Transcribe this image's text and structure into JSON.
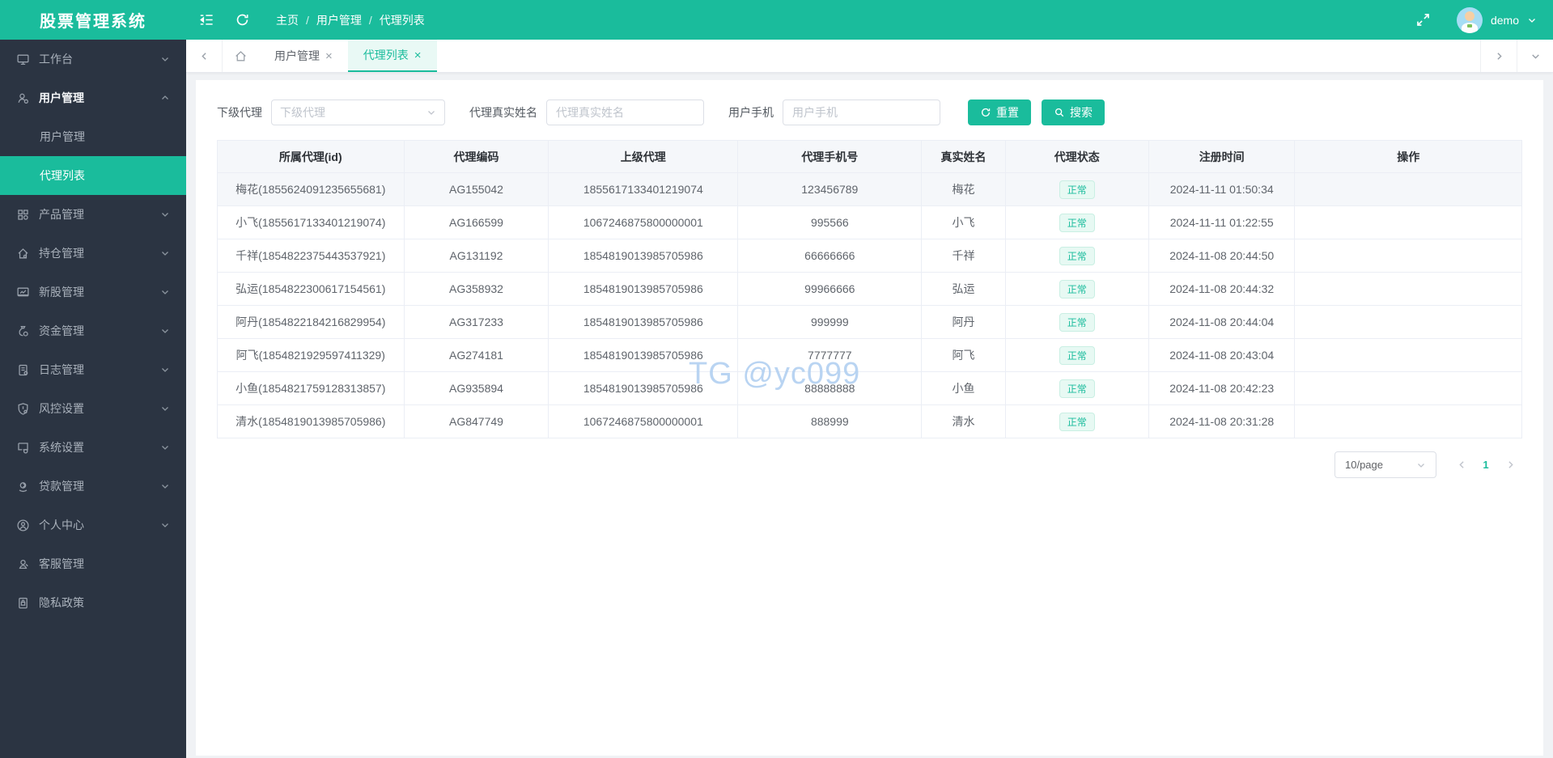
{
  "app": {
    "title": "股票管理系统"
  },
  "header": {
    "breadcrumb": [
      "主页",
      "用户管理",
      "代理列表"
    ],
    "username": "demo",
    "icons": [
      "menu-fold-icon",
      "refresh-icon",
      "fullscreen-icon",
      "avatar",
      "caret-down-icon"
    ]
  },
  "sidebar": {
    "items": [
      {
        "label": "工作台",
        "icon": "workbench-icon",
        "chevron": true
      },
      {
        "label": "用户管理",
        "icon": "users-icon",
        "chevron": true,
        "expanded": true
      },
      {
        "label": "用户管理",
        "is_sub": true
      },
      {
        "label": "代理列表",
        "is_sub": true,
        "active": true
      },
      {
        "label": "产品管理",
        "icon": "products-icon",
        "chevron": true
      },
      {
        "label": "持仓管理",
        "icon": "positions-icon",
        "chevron": true
      },
      {
        "label": "新股管理",
        "icon": "newstock-icon",
        "chevron": true
      },
      {
        "label": "资金管理",
        "icon": "funds-icon",
        "chevron": true
      },
      {
        "label": "日志管理",
        "icon": "logs-icon",
        "chevron": true
      },
      {
        "label": "风控设置",
        "icon": "risk-icon",
        "chevron": true
      },
      {
        "label": "系统设置",
        "icon": "system-icon",
        "chevron": true
      },
      {
        "label": "贷款管理",
        "icon": "loan-icon",
        "chevron": true
      },
      {
        "label": "个人中心",
        "icon": "profile-icon",
        "chevron": true
      },
      {
        "label": "客服管理",
        "icon": "service-icon"
      },
      {
        "label": "隐私政策",
        "icon": "privacy-icon"
      }
    ]
  },
  "tabs": {
    "items": [
      {
        "label": "用户管理",
        "active": false
      },
      {
        "label": "代理列表",
        "active": true
      }
    ]
  },
  "filters": {
    "agent_select": {
      "label": "下级代理",
      "placeholder": "下级代理"
    },
    "real_name": {
      "label": "代理真实姓名",
      "placeholder": "代理真实姓名",
      "value": ""
    },
    "phone": {
      "label": "用户手机",
      "placeholder": "用户手机",
      "value": ""
    },
    "reset_label": "重置",
    "search_label": "搜索"
  },
  "table": {
    "columns": [
      "所属代理(id)",
      "代理编码",
      "上级代理",
      "代理手机号",
      "真实姓名",
      "代理状态",
      "注册时间",
      "操作"
    ],
    "rows": [
      {
        "agent": "梅花(1855624091235655681)",
        "code": "AG155042",
        "parent": "1855617133401219074",
        "phone": "123456789",
        "name": "梅花",
        "status": "正常",
        "time": "2024-11-11 01:50:34",
        "highlight": true
      },
      {
        "agent": "小飞(1855617133401219074)",
        "code": "AG166599",
        "parent": "1067246875800000001",
        "phone": "995566",
        "name": "小飞",
        "status": "正常",
        "time": "2024-11-11 01:22:55"
      },
      {
        "agent": "千祥(1854822375443537921)",
        "code": "AG131192",
        "parent": "1854819013985705986",
        "phone": "66666666",
        "name": "千祥",
        "status": "正常",
        "time": "2024-11-08 20:44:50"
      },
      {
        "agent": "弘运(1854822300617154561)",
        "code": "AG358932",
        "parent": "1854819013985705986",
        "phone": "99966666",
        "name": "弘运",
        "status": "正常",
        "time": "2024-11-08 20:44:32"
      },
      {
        "agent": "阿丹(1854822184216829954)",
        "code": "AG317233",
        "parent": "1854819013985705986",
        "phone": "999999",
        "name": "阿丹",
        "status": "正常",
        "time": "2024-11-08 20:44:04"
      },
      {
        "agent": "阿飞(1854821929597411329)",
        "code": "AG274181",
        "parent": "1854819013985705986",
        "phone": "7777777",
        "name": "阿飞",
        "status": "正常",
        "time": "2024-11-08 20:43:04"
      },
      {
        "agent": "小鱼(1854821759128313857)",
        "code": "AG935894",
        "parent": "1854819013985705986",
        "phone": "88888888",
        "name": "小鱼",
        "status": "正常",
        "time": "2024-11-08 20:42:23"
      },
      {
        "agent": "清水(1854819013985705986)",
        "code": "AG847749",
        "parent": "1067246875800000001",
        "phone": "888999",
        "name": "清水",
        "status": "正常",
        "time": "2024-11-08 20:31:28"
      }
    ]
  },
  "pagination": {
    "page_size": "10/page",
    "current_page": "1"
  },
  "watermark": "TG @yc099",
  "colors": {
    "primary": "#1abc9c",
    "sidebar_bg": "#2b3442",
    "status_badge_bg": "#e7f9f3",
    "status_badge_text": "#1abc9c",
    "content_bg": "#f0f2f5",
    "watermark_text": "#add0ef"
  }
}
